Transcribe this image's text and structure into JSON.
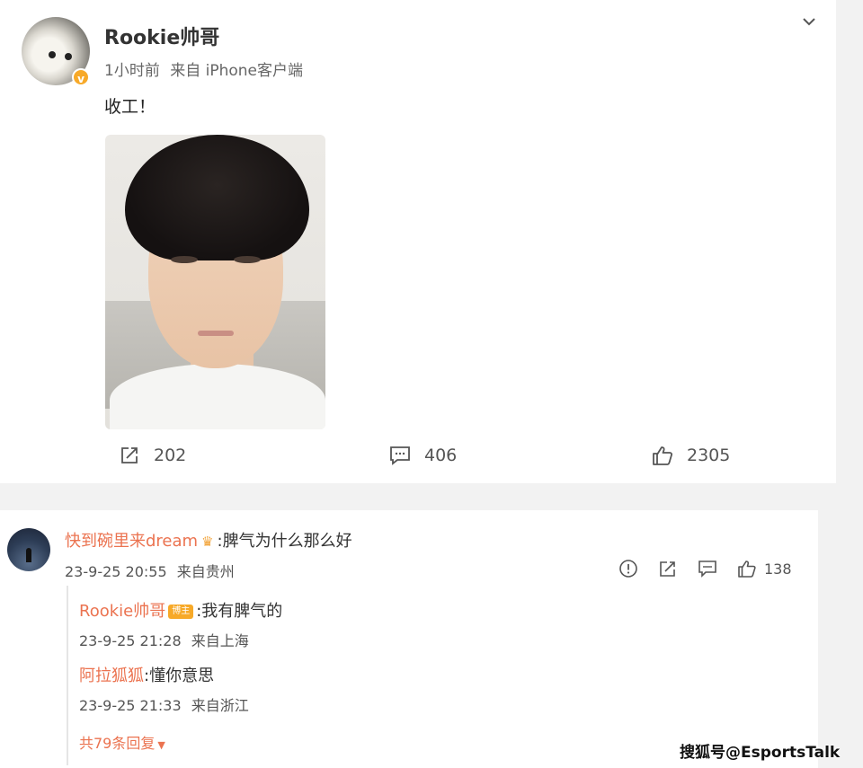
{
  "post": {
    "username": "Rookie帅哥",
    "time": "1小时前",
    "source": "来自 iPhone客户端",
    "text": "收工！",
    "icons": {
      "verified": "verified-badge-icon",
      "menu": "chevron-down-icon"
    },
    "actions": {
      "shares": "202",
      "comments": "406",
      "likes": "2305"
    }
  },
  "comment": {
    "author": "快到碗里来dream",
    "text": ":脾气为什么那么好",
    "date": "23-9-25 20:55",
    "location": "来自贵州",
    "likes": "138",
    "replies": [
      {
        "author": "Rookie帅哥",
        "badge": "博主",
        "text": ":我有脾气的",
        "date": "23-9-25 21:28",
        "location": "来自上海"
      },
      {
        "author": "阿拉狐狐",
        "text": ":懂你意思",
        "date": "23-9-25 21:33",
        "location": "来自浙江"
      }
    ],
    "more_replies": "共79条回复"
  },
  "watermark": "搜狐号@EsportsTalk",
  "colors": {
    "accent": "#eb7350",
    "verified": "#f7a928",
    "background": "#f2f2f2"
  }
}
